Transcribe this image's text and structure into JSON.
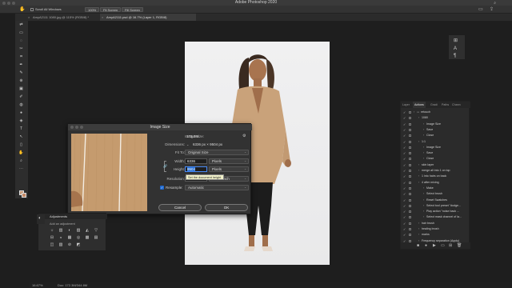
{
  "window": {
    "title": "Adobe Photoshop 2020"
  },
  "options_bar": {
    "scroll_all_windows": "Scroll All Windows",
    "zoom_100": "100%",
    "fit_screen": "Fit Screen",
    "fill_screen": "Fill Screen"
  },
  "tabs": [
    {
      "label": "AmyA2111 1080.jpg @ 115% (RGB/8) *",
      "active": false
    },
    {
      "label": "AmyA2111.psd @ 16.7% (Layer 1, RGB/8)",
      "active": true
    }
  ],
  "tools": [
    "⇄",
    "▭",
    "◌",
    "✂",
    "⌗",
    "✒",
    "✎",
    "⊕",
    "▣",
    "✐",
    "◍",
    "●",
    "◈",
    "T",
    "↖",
    "▯",
    "✋",
    "⌕",
    "⋯"
  ],
  "colors": {
    "foreground": "#c89a78",
    "background": "#c68a66",
    "accent": "#1f6ad1"
  },
  "dialog": {
    "title": "Image Size",
    "image_size_label": "Image Size:",
    "image_size_value": "172.3M",
    "dimensions_label": "Dimensions:",
    "dimensions_value": "6336 px  ×  9504 px",
    "fit_to_label": "Fit To:",
    "fit_to_value": "Original Size",
    "width_label": "Width:",
    "width_value": "6336",
    "width_unit": "Pixels",
    "height_label": "Height:",
    "height_value": "9504",
    "height_unit": "Pixels",
    "resolution_label": "Resolution:",
    "resolution_unit": "Pixels/Inch",
    "resample_label": "Resample:",
    "resample_value": "Automatic",
    "cancel": "Cancel",
    "ok": "OK",
    "tooltip": "Set the document height"
  },
  "actions_panel": {
    "tabs": [
      "Layer",
      "Actions",
      "Gradi",
      "Paths",
      "Chann"
    ],
    "rows": [
      {
        "text": "retouch",
        "indent": 0,
        "folder": true
      },
      {
        "text": "1080",
        "indent": 1
      },
      {
        "text": "Image Size",
        "indent": 2
      },
      {
        "text": "Save",
        "indent": 2
      },
      {
        "text": "Close",
        "indent": 2
      },
      {
        "text": "1:1",
        "indent": 1
      },
      {
        "text": "Image Size",
        "indent": 2
      },
      {
        "text": "Save",
        "indent": 2
      },
      {
        "text": "Close",
        "indent": 2
      },
      {
        "text": "skin layer",
        "indent": 1
      },
      {
        "text": "merge all into 1 on top",
        "indent": 1
      },
      {
        "text": "1 into hairs on back",
        "indent": 1
      },
      {
        "text": "4 after mixing",
        "indent": 1
      },
      {
        "text": "Make",
        "indent": 2
      },
      {
        "text": "Select brush",
        "indent": 2
      },
      {
        "text": "Reset Swatches",
        "indent": 2
      },
      {
        "text": "Select tool preset \"dodge...",
        "indent": 2
      },
      {
        "text": "Play action \"noise back ...",
        "indent": 2
      },
      {
        "text": "Select mask channel of la...",
        "indent": 2
      },
      {
        "text": "hair brush",
        "indent": 1
      },
      {
        "text": "healing brush",
        "indent": 1
      },
      {
        "text": "marks",
        "indent": 1
      },
      {
        "text": "Frequency separation (Apply)",
        "indent": 1
      }
    ]
  },
  "adjustments": {
    "title": "Adjustments",
    "subtitle": "Add an adjustment",
    "icons_row1": [
      "☼",
      "▥",
      "◐",
      "▨",
      "◭",
      "▽"
    ],
    "icons_row2": [
      "⊟",
      "◒",
      "▦",
      "◎",
      "▩",
      "▤"
    ],
    "icons_row3": [
      "◫",
      "▧",
      "⊘",
      "◩"
    ]
  },
  "status": {
    "zoom": "16.67%",
    "doc": "Doc: 172.3M/344.6M"
  }
}
